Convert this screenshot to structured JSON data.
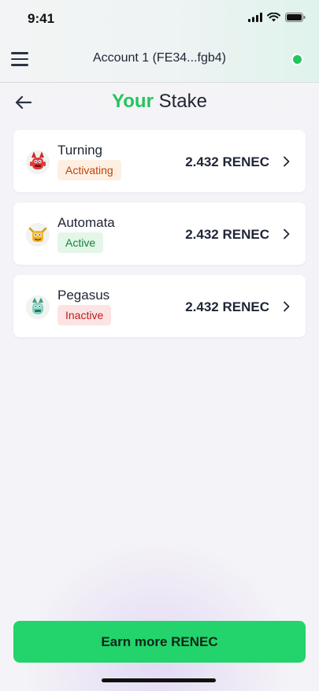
{
  "status_bar": {
    "time": "9:41"
  },
  "header": {
    "account_label": "Account 1 (FE34...fgb4)",
    "status_color": "#22c55e"
  },
  "page": {
    "title_accent": "Your",
    "title_rest": "Stake"
  },
  "stakes": [
    {
      "name": "Turning",
      "status": "Activating",
      "amount": "2.432 RENEC",
      "avatar": "red-monster-icon"
    },
    {
      "name": "Automata",
      "status": "Active",
      "amount": "2.432 RENEC",
      "avatar": "yellow-monster-icon"
    },
    {
      "name": "Pegasus",
      "status": "Inactive",
      "amount": "2.432 RENEC",
      "avatar": "teal-monster-icon"
    }
  ],
  "footer": {
    "earn_button": "Earn more RENEC"
  },
  "colors": {
    "accent": "#22c55e",
    "button": "#22d46b",
    "activating": "#c2410c",
    "active": "#15803d",
    "inactive": "#b91c1c"
  }
}
